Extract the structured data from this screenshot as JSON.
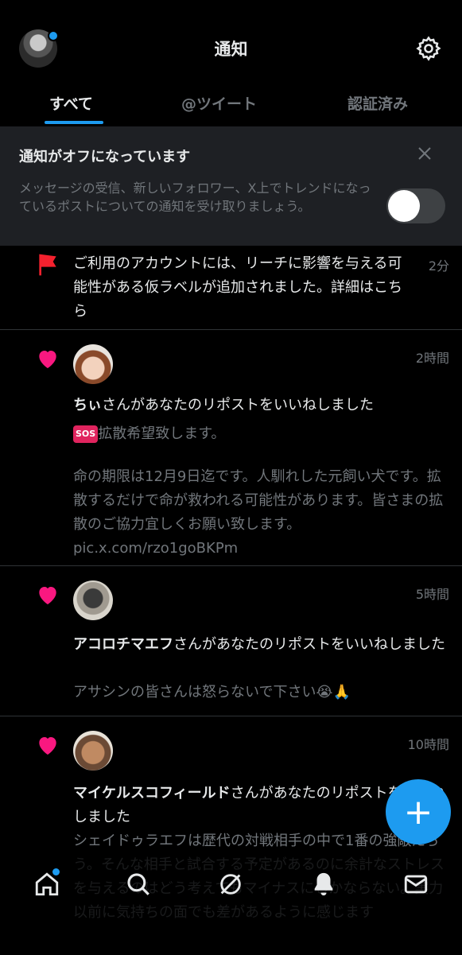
{
  "header": {
    "title": "通知"
  },
  "tabs": [
    {
      "label": "すべて",
      "active": true
    },
    {
      "label": "@ツイート",
      "active": false
    },
    {
      "label": "認証済み",
      "active": false
    }
  ],
  "banner": {
    "title": "通知がオフになっています",
    "body": "メッセージの受信、新しいフォロワー、X上でトレンドになっているポストについての通知を受け取りましょう。",
    "toggle_on": false
  },
  "notifications": [
    {
      "type": "flag",
      "text": "ご利用のアカウントには、リーチに影響を与える可能性がある仮ラベルが追加されました。詳細はこちら",
      "time": "2分"
    },
    {
      "type": "like",
      "user": "ちぃ",
      "action": "さんがあなたのリポストをいいねしました",
      "sos": "SOS",
      "excerpt_line1": "拡散希望致します。",
      "excerpt_body": "命の期限は12月9日迄です。人馴れした元飼い犬です。拡散するだけで命が救われる可能性があります。皆さまの拡散のご協力宜しくお願い致します。 pic.x.com/rzo1goBKPm",
      "time": "2時間"
    },
    {
      "type": "like",
      "user": "アコロチマエフ",
      "action": "さんがあなたのリポストをいいねしました",
      "excerpt": "アサシンの皆さんは怒らないで下さい😭🙏",
      "time": "5時間"
    },
    {
      "type": "like",
      "user": "マイケルスコフィールド",
      "action": "さんがあなたのリポストをいいねしました",
      "excerpt": "シェイドゥラエフは歴代の対戦相手の中で1番の強敵だろう。そんな相手と試合する予定があるのに余計なストレスを与えるのはどう考えてもマイナスにしかならない。実力以前に気持ちの面でも差があるように感じます",
      "time": "10時間"
    }
  ],
  "fab": {
    "label": "+"
  },
  "bottom_nav": [
    "home-icon",
    "search-icon",
    "grok-icon",
    "bell-icon",
    "mail-icon"
  ],
  "colors": {
    "accent": "#1d9bf0",
    "heart": "#f91880",
    "flag": "#f4212e",
    "secondary_text": "#71767b"
  }
}
